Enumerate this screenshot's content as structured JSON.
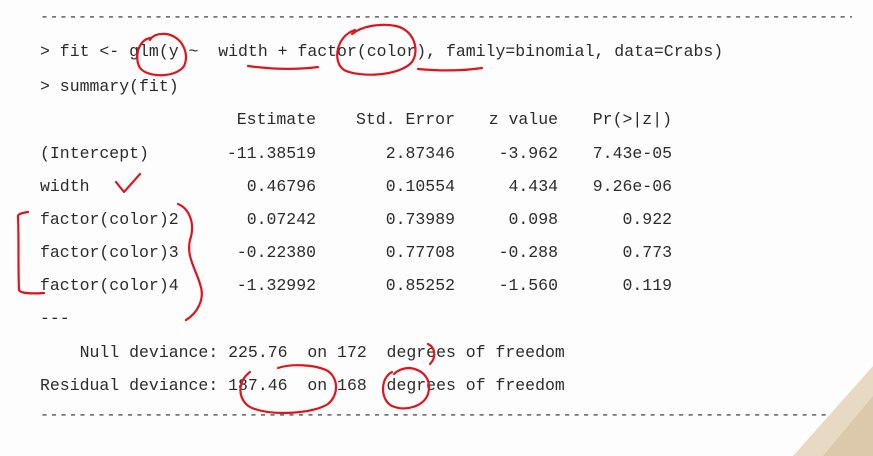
{
  "rule_line": "--------------------------------------------------------------------------------------------------------------------",
  "command1": "> fit <- glm(y ~  width + factor(color), family=binomial, data=Crabs)",
  "command2": "> summary(fit)",
  "table": {
    "headers": [
      "Estimate",
      "Std. Error",
      "z value",
      "Pr(>|z|)"
    ],
    "rows": [
      {
        "name": "(Intercept)",
        "estimate": "-11.38519",
        "std_error": "2.87346",
        "z_value": "-3.962",
        "p_value": "7.43e-05"
      },
      {
        "name": "width",
        "estimate": "0.46796",
        "std_error": "0.10554",
        "z_value": "4.434",
        "p_value": "9.26e-06"
      },
      {
        "name": "factor(color)2",
        "estimate": "0.07242",
        "std_error": "0.73989",
        "z_value": "0.098",
        "p_value": "0.922"
      },
      {
        "name": "factor(color)3",
        "estimate": "-0.22380",
        "std_error": "0.77708",
        "z_value": "-0.288",
        "p_value": "0.773"
      },
      {
        "name": "factor(color)4",
        "estimate": "-1.32992",
        "std_error": "0.85252",
        "z_value": "-1.560",
        "p_value": "0.119"
      }
    ]
  },
  "separator": "---",
  "null_deviance": "    Null deviance: 225.76  on 172  degrees of freedom",
  "residual_deviance": "Residual deviance: 187.46  on 168  degrees of freedom",
  "colors": {
    "annotation": "#e0141e",
    "text": "#2b2b2b",
    "corner": "#e8d9c3"
  }
}
